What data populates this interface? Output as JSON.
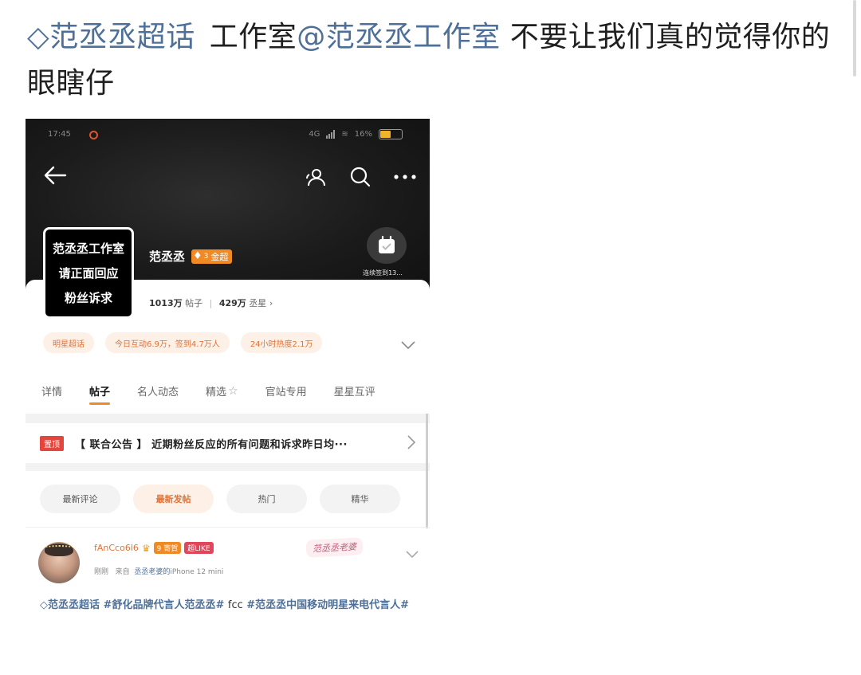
{
  "post": {
    "supertopic_link": "范丞丞超话",
    "text_a": "工作室",
    "mention": "@范丞丞工作室",
    "text_b": "不要让我们真的觉得你的眼瞎仔"
  },
  "screenshot": {
    "status": {
      "time": "17:45",
      "battery": "16%",
      "network": "4G"
    },
    "profile": {
      "avatar_lines": [
        "范丞丞工作室",
        "请正面回应",
        "粉丝诉求"
      ],
      "name": "范丞丞",
      "badge": "金超",
      "badge_level": "3",
      "signin_label": "连续签到13...",
      "posts_count": "1013万",
      "posts_label": "帖子",
      "fans_count": "429万",
      "fans_label": "丞星"
    },
    "chips": [
      "明星超话",
      "今日互动6.9万，签到4.7万人",
      "24小时热度2.1万"
    ],
    "tabs": [
      "详情",
      "帖子",
      "名人动态",
      "精选",
      "官站专用",
      "星星互评"
    ],
    "active_tab": "帖子",
    "pinned": {
      "badge": "置顶",
      "text": "【 联合公告 】 近期粉丝反应的所有问题和诉求昨日均···"
    },
    "filters": [
      "最新评论",
      "最新发帖",
      "热门",
      "精华"
    ],
    "active_filter": "最新发帖",
    "feed_post": {
      "username": "fAnCco6l6",
      "level_badge": "寄賀",
      "level_num": "9",
      "like_badge": "超LIKE",
      "time": "刚刚",
      "from_label": "来自",
      "source_hl": "丞丞老婆的",
      "source_device": "iPhone 12 mini",
      "sticker": "范丞丞老婆",
      "tag1": "范丞丞超话",
      "tag2": "#舒化品牌代言人范丞丞#",
      "plain": "fcc",
      "tag3": "#范丞丞中国移动明星来电代言人#"
    }
  },
  "colors": {
    "link": "#4e6f98",
    "accent": "#f08a24",
    "pin": "#e3463c"
  }
}
